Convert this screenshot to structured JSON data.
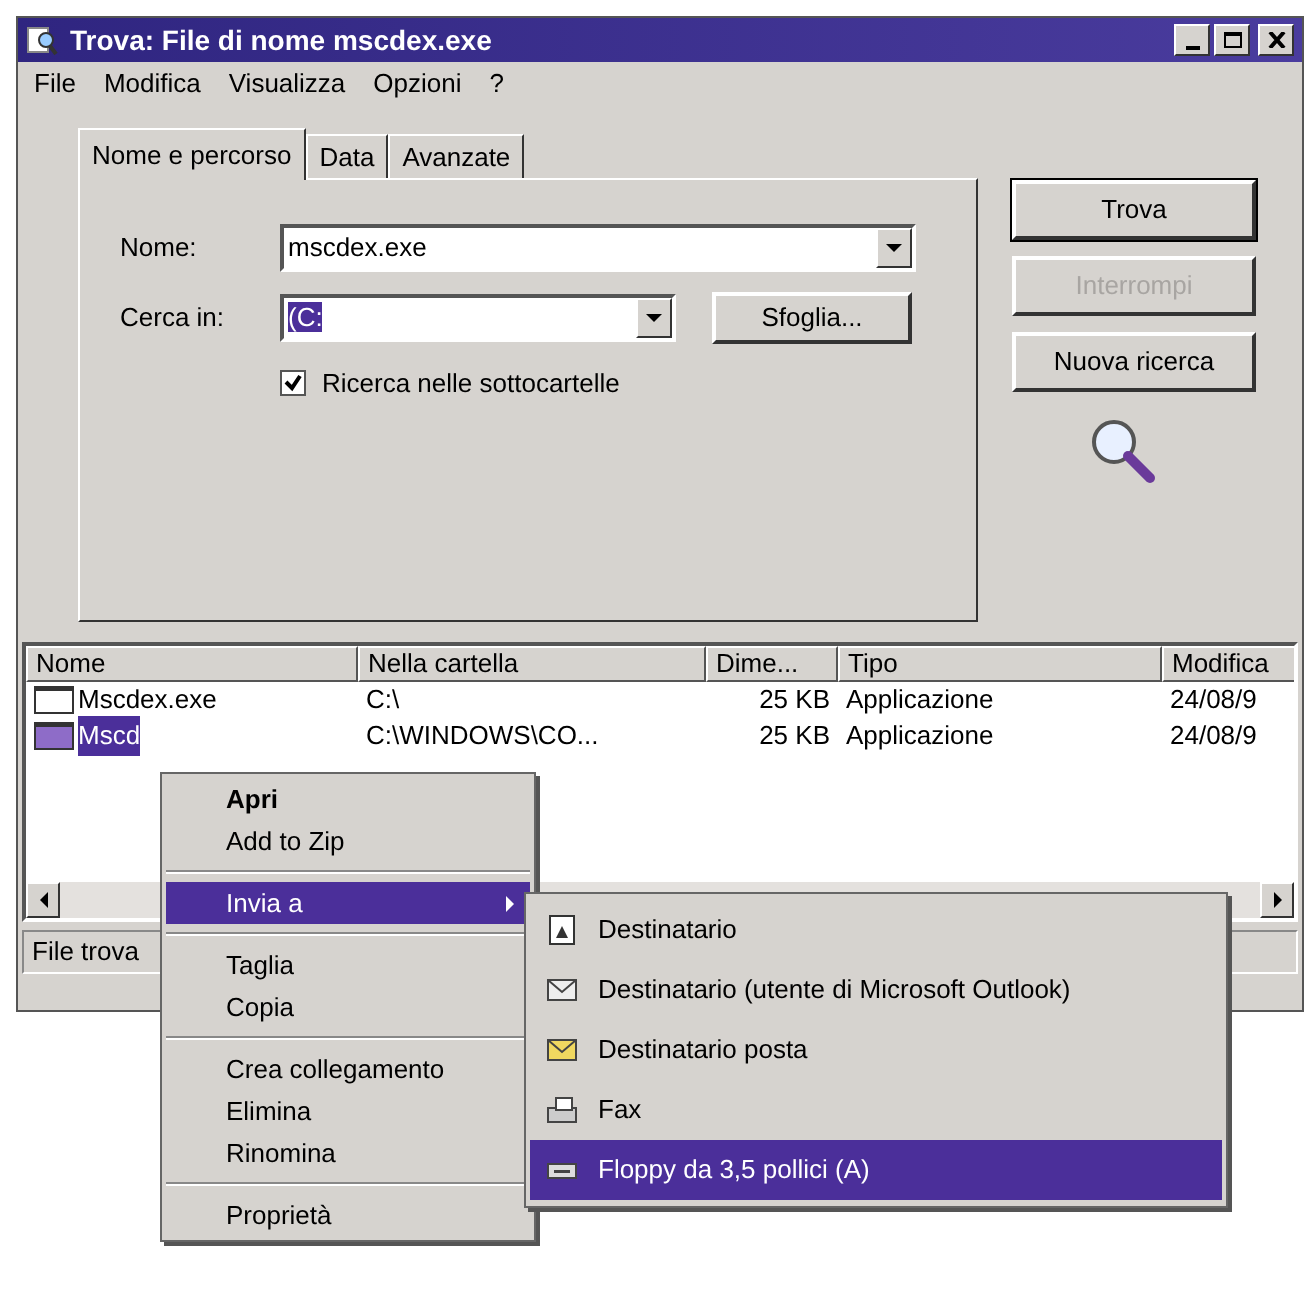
{
  "window": {
    "title": "Trova: File di nome mscdex.exe"
  },
  "menu_bar": [
    "File",
    "Modifica",
    "Visualizza",
    "Opzioni",
    "?"
  ],
  "tabs": [
    {
      "label": "Nome e percorso",
      "selected": true
    },
    {
      "label": "Data",
      "selected": false
    },
    {
      "label": "Avanzate",
      "selected": false
    }
  ],
  "name_field": {
    "label": "Nome:",
    "value": "mscdex.exe"
  },
  "look_in_field": {
    "label": "Cerca in:",
    "value": "(C:"
  },
  "browse_button": "Sfoglia...",
  "subfolders_checkbox": {
    "label": "Ricerca nelle sottocartelle",
    "checked": true
  },
  "buttons": [
    {
      "label": "Trova",
      "disabled": false,
      "default": true
    },
    {
      "label": "Interrompi",
      "disabled": true,
      "default": false
    },
    {
      "label": "Nuova ricerca",
      "disabled": false,
      "default": false
    }
  ],
  "results": {
    "columns": [
      "Nome",
      "Nella cartella",
      "Dime...",
      "Tipo",
      "Modifica"
    ],
    "rows": [
      {
        "cells": [
          "Mscdex.exe",
          "C:\\",
          "25 KB",
          "Applicazione",
          "24/08/9"
        ],
        "selected": false
      },
      {
        "cells": [
          "Mscd",
          "C:\\WINDOWS\\CO...",
          "25 KB",
          "Applicazione",
          "24/08/9"
        ],
        "selected": true
      }
    ]
  },
  "status_bar": "File trova",
  "context_menu": [
    {
      "kind": "item",
      "label": "Apri",
      "default": true,
      "selected": false
    },
    {
      "kind": "item",
      "label": "Add to Zip",
      "default": false,
      "selected": false
    },
    {
      "kind": "separator"
    },
    {
      "kind": "submenu",
      "label": "Invia a",
      "default": false,
      "selected": true
    },
    {
      "kind": "separator"
    },
    {
      "kind": "item",
      "label": "Taglia",
      "default": false,
      "selected": false
    },
    {
      "kind": "item",
      "label": "Copia",
      "default": false,
      "selected": false
    },
    {
      "kind": "separator"
    },
    {
      "kind": "item",
      "label": "Crea collegamento",
      "default": false,
      "selected": false
    },
    {
      "kind": "item",
      "label": "Elimina",
      "default": false,
      "selected": false
    },
    {
      "kind": "item",
      "label": "Rinomina",
      "default": false,
      "selected": false
    },
    {
      "kind": "separator"
    },
    {
      "kind": "item",
      "label": "Proprietà",
      "default": false,
      "selected": false
    }
  ],
  "send_to_menu": [
    {
      "kind": "recipient",
      "label": "Destinatario",
      "selected": false
    },
    {
      "kind": "outlook",
      "label": "Destinatario (utente di Microsoft Outlook)",
      "selected": false
    },
    {
      "kind": "mail",
      "label": "Destinatario posta",
      "selected": false
    },
    {
      "kind": "fax",
      "label": "Fax",
      "selected": false
    },
    {
      "kind": "floppy",
      "label": "Floppy da 3,5 pollici (A)",
      "selected": true
    }
  ]
}
